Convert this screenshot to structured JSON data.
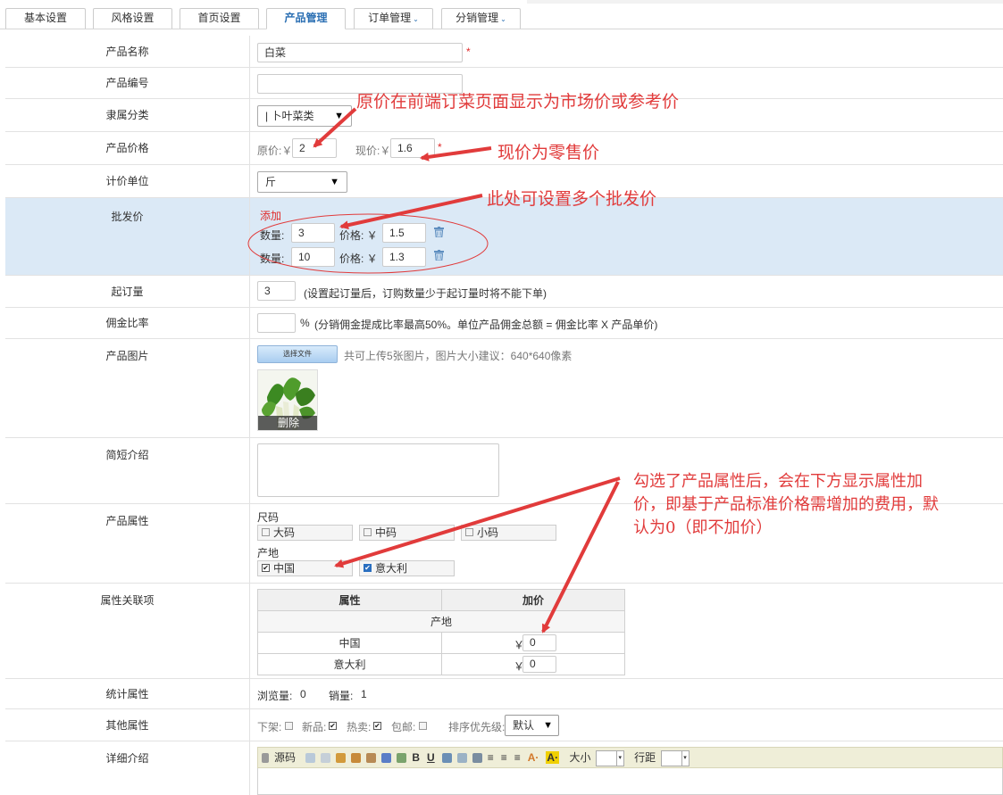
{
  "tabs": [
    {
      "label": "基本设置"
    },
    {
      "label": "风格设置"
    },
    {
      "label": "首页设置"
    },
    {
      "label": "产品管理"
    },
    {
      "label": "订单管理"
    },
    {
      "label": "分销管理"
    }
  ],
  "form": {
    "name": {
      "label": "产品名称",
      "value": "白菜",
      "required": "*"
    },
    "code": {
      "label": "产品编号",
      "value": ""
    },
    "category": {
      "label": "隶属分类",
      "selected": "|  卜叶菜类"
    },
    "price": {
      "label": "产品价格",
      "orig_label": "原价:￥",
      "orig_value": "2",
      "cur_label": "现价:￥",
      "cur_value": "1.6",
      "required": "*"
    },
    "unit": {
      "label": "计价单位",
      "selected": "斤"
    },
    "wholesale": {
      "label": "批发价",
      "add_link": "添加",
      "qty_label": "数量:",
      "price_label": "价格:  ￥",
      "rows": [
        {
          "qty": "3",
          "price": "1.5"
        },
        {
          "qty": "10",
          "price": "1.3"
        }
      ]
    },
    "min_order": {
      "label": "起订量",
      "value": "3",
      "hint": "(设置起订量后，订购数量少于起订量时将不能下单)"
    },
    "commission": {
      "label": "佣金比率",
      "value": "",
      "unit": "%",
      "hint": "(分销佣金提成比率最高50%。单位产品佣金总额 = 佣金比率 X 产品单价)"
    },
    "images": {
      "label": "产品图片",
      "choose_button": "选择文件",
      "hint": "共可上传5张图片，图片大小建议：640*640像素",
      "delete_label": "删除"
    },
    "summary": {
      "label": "简短介绍",
      "value": ""
    },
    "attributes": {
      "label": "产品属性",
      "groups": [
        {
          "name": "尺码",
          "options": [
            {
              "label": "大码",
              "checked": false
            },
            {
              "label": "中码",
              "checked": false
            },
            {
              "label": "小码",
              "checked": false
            }
          ]
        },
        {
          "name": "产地",
          "options": [
            {
              "label": "中国",
              "checked": true
            },
            {
              "label": "意大利",
              "checked": true
            }
          ]
        }
      ]
    },
    "linked": {
      "label": "属性关联项",
      "col_attr": "属性",
      "col_price": "加价",
      "group": "产地",
      "currency": "￥",
      "rows": [
        {
          "name": "中国",
          "value": "0"
        },
        {
          "name": "意大利",
          "value": "0"
        }
      ]
    },
    "stats": {
      "label": "统计属性",
      "views_label": "浏览量:",
      "views": "0",
      "sales_label": "销量:",
      "sales": "1"
    },
    "other": {
      "label": "其他属性",
      "off_shelf": "下架:",
      "new": "新品:",
      "hot": "热卖:",
      "free_ship": "包邮:",
      "sort_label": "排序优先级:",
      "sort_value": "默认",
      "new_checked": true,
      "hot_checked": true
    },
    "detail": {
      "label": "详细介绍",
      "toolbar": {
        "source": "源码",
        "size_label": "大小",
        "spacing_label": "行距"
      }
    }
  },
  "annotations": {
    "a1": "原价在前端订菜页面显示为市场价或参考价",
    "a2": "现价为零售价",
    "a3": "此处可设置多个批发价",
    "a4_l1": "勾选了产品属性后，会在下方显示属性加",
    "a4_l2": "价，即基于产品标准价格需增加的费用，默",
    "a4_l3": "认为0（即不加价）"
  },
  "colors": {
    "accent": "#2b6fb3",
    "annotation": "#e13b3b",
    "wholesale_bg": "#dbe9f6"
  }
}
